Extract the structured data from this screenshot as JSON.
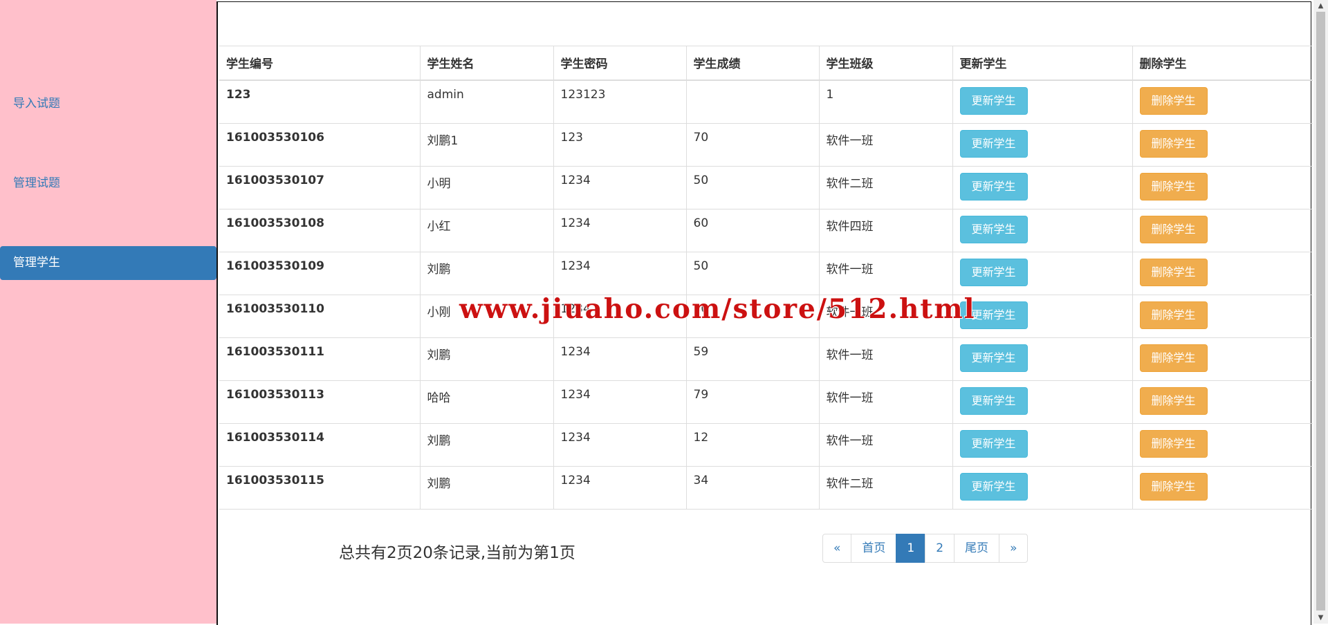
{
  "sidebar": {
    "items": [
      {
        "label": "导入试题",
        "active": false
      },
      {
        "label": "管理试题",
        "active": false
      },
      {
        "label": "管理学生",
        "active": true
      }
    ]
  },
  "table": {
    "headers": [
      "学生编号",
      "学生姓名",
      "学生密码",
      "学生成绩",
      "学生班级",
      "更新学生",
      "删除学生"
    ],
    "rows": [
      {
        "id": "123",
        "name": "admin",
        "password": "123123",
        "score": "",
        "class": "1"
      },
      {
        "id": "161003530106",
        "name": "刘鹏1",
        "password": "123",
        "score": "70",
        "class": "软件一班"
      },
      {
        "id": "161003530107",
        "name": "小明",
        "password": "1234",
        "score": "50",
        "class": "软件二班"
      },
      {
        "id": "161003530108",
        "name": "小红",
        "password": "1234",
        "score": "60",
        "class": "软件四班"
      },
      {
        "id": "161003530109",
        "name": "刘鹏",
        "password": "1234",
        "score": "50",
        "class": "软件一班"
      },
      {
        "id": "161003530110",
        "name": "小刚",
        "password": "1234",
        "score": "80",
        "class": "软件一班"
      },
      {
        "id": "161003530111",
        "name": "刘鹏",
        "password": "1234",
        "score": "59",
        "class": "软件一班"
      },
      {
        "id": "161003530113",
        "name": "哈哈",
        "password": "1234",
        "score": "79",
        "class": "软件一班"
      },
      {
        "id": "161003530114",
        "name": "刘鹏",
        "password": "1234",
        "score": "12",
        "class": "软件一班"
      },
      {
        "id": "161003530115",
        "name": "刘鹏",
        "password": "1234",
        "score": "34",
        "class": "软件二班"
      }
    ],
    "update_label": "更新学生",
    "delete_label": "删除学生"
  },
  "footer": {
    "summary": "总共有2页20条记录,当前为第1页",
    "pagination": [
      {
        "label": "«",
        "active": false
      },
      {
        "label": "首页",
        "active": false
      },
      {
        "label": "1",
        "active": true
      },
      {
        "label": "2",
        "active": false
      },
      {
        "label": "尾页",
        "active": false
      },
      {
        "label": "»",
        "active": false
      }
    ]
  },
  "watermark": "www.jiuaho.com/store/512.html",
  "colors": {
    "sidebar_bg": "#ffc0cb",
    "primary": "#337ab7",
    "info": "#5bc0de",
    "warning": "#f0ad4e"
  }
}
